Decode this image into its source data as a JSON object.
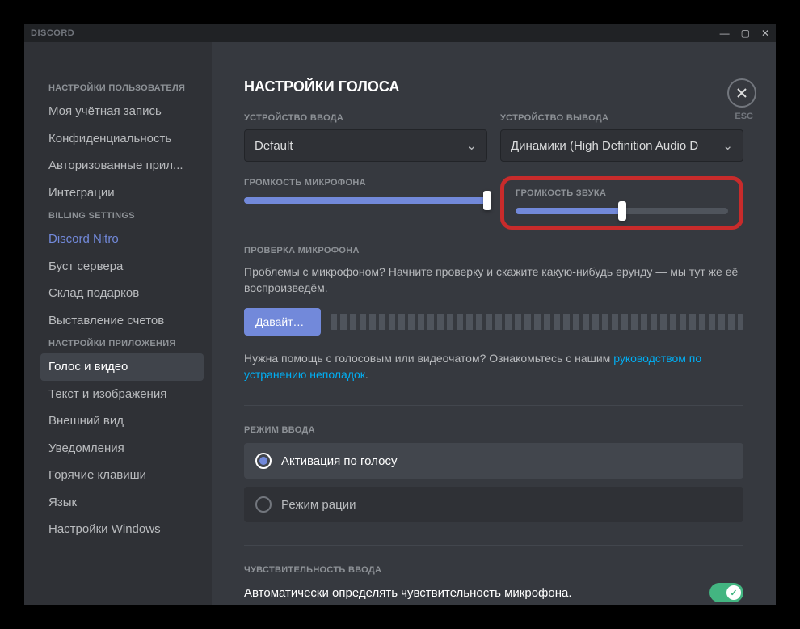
{
  "brand": "DISCORD",
  "close_label": "ESC",
  "sidebar": {
    "groups": [
      {
        "header": "НАСТРОЙКИ ПОЛЬЗОВАТЕЛЯ",
        "items": [
          {
            "label": "Моя учётная запись"
          },
          {
            "label": "Конфиденциальность"
          },
          {
            "label": "Авторизованные прил..."
          },
          {
            "label": "Интеграции"
          }
        ]
      },
      {
        "header": "BILLING SETTINGS",
        "items": [
          {
            "label": "Discord Nitro",
            "nitro": true
          },
          {
            "label": "Буст сервера"
          },
          {
            "label": "Склад подарков"
          },
          {
            "label": "Выставление счетов"
          }
        ]
      },
      {
        "header": "НАСТРОЙКИ ПРИЛОЖЕНИЯ",
        "items": [
          {
            "label": "Голос и видео",
            "selected": true
          },
          {
            "label": "Текст и изображения"
          },
          {
            "label": "Внешний вид"
          },
          {
            "label": "Уведомления"
          },
          {
            "label": "Горячие клавиши"
          },
          {
            "label": "Язык"
          },
          {
            "label": "Настройки Windows"
          }
        ]
      }
    ]
  },
  "page": {
    "title": "НАСТРОЙКИ ГОЛОСА",
    "input_device_label": "УСТРОЙСТВО ВВОДА",
    "input_device_value": "Default",
    "output_device_label": "УСТРОЙСТВО ВЫВОДА",
    "output_device_value": "Динамики (High Definition Audio D",
    "mic_volume_label": "ГРОМКОСТЬ МИКРОФОНА",
    "mic_volume_pct": 100,
    "output_volume_label": "ГРОМКОСТЬ ЗВУКА",
    "output_volume_pct": 50,
    "mic_test_label": "ПРОВЕРКА МИКРОФОНА",
    "mic_test_help": "Проблемы с микрофоном? Начните проверку и скажите какую-нибудь ерунду — мы тут же её воспроизведём.",
    "mic_test_button": "Давайте пр...",
    "help_prefix": "Нужна помощь с голосовым или видеочатом? Ознакомьтесь с нашим ",
    "help_link": "руководством по устранению неполадок",
    "help_suffix": ".",
    "input_mode_label": "РЕЖИМ ВВОДА",
    "input_mode_voice": "Активация по голосу",
    "input_mode_ptt": "Режим рации",
    "sensitivity_label": "ЧУВСТВИТЕЛЬНОСТЬ ВВОДА",
    "auto_sensitivity": "Автоматически определять чувствительность микрофона."
  }
}
